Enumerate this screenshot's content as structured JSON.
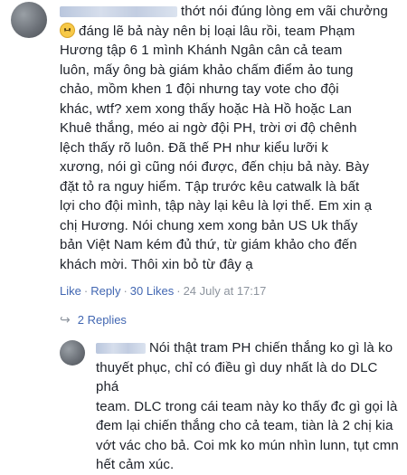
{
  "comment1": {
    "lines": [
      "thớt nói đúng lòng em vãi chưởng",
      "đáng lẽ bả này nên bị loại lâu rồi, team Phạm",
      "Hương tập 6 1 mình Khánh Ngân cân cả team",
      "luôn, mấy ông bà giám khảo chấm điểm ảo tung",
      "chảo, mồm khen 1 đội nhưng tay vote cho đội",
      "khác, wtf? xem xong thấy hoặc Hà Hồ hoặc Lan",
      "Khuê thắng, méo ai ngờ đội PH, trời ơi độ chênh",
      "lệch thấy rõ luôn. Đã thế PH như kiểu lưỡi k",
      "xương, nói gì cũng nói được, đến chịu bả này. Bày",
      "đặt tỏ ra nguy hiểm. Tập trước kêu catwalk là bất",
      "lợi cho đội mình, tập này lại kêu là lợi thế. Em xin ạ",
      "chị Hương. Nói chung xem xong bản US Uk thấy",
      "bản Việt Nam kém đủ thứ, từ giám khảo cho đến",
      "khách mời. Thôi xin bỏ từ đây ạ"
    ],
    "emoji_icon": "sad-face",
    "actions": {
      "like": "Like",
      "reply": "Reply",
      "likes_count": "30 Likes",
      "timestamp": "24 July at 17:17"
    },
    "replies_label": "2 Replies"
  },
  "comment2": {
    "lines": [
      "Nói thật tram PH chiến thắng ko gì là ko",
      "thuyết phục, chỉ có điều gì duy nhất là do DLC phá",
      "team. DLC trong cái team này ko thấy đc gì gọi là",
      "đem lại chiến thắng cho cả team, tiàn là 2 chị kia",
      "vớt vác cho bả. Coi mk ko mún nhìn lunn, tụt cmn",
      "hết cảm xúc."
    ]
  },
  "colors": {
    "text": "#1d2129",
    "link": "#4267b2",
    "meta": "#8d949e"
  }
}
